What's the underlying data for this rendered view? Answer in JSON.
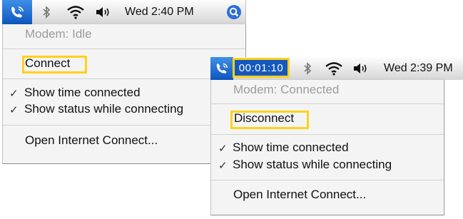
{
  "screen_before": {
    "menubar": {
      "clock": "Wed 2:40 PM"
    },
    "menu": {
      "status": "Modem: Idle",
      "action": "Connect",
      "option_time": "Show time connected",
      "option_status": "Show status while connecting",
      "open_app": "Open Internet Connect..."
    }
  },
  "screen_after": {
    "menubar": {
      "timer": "00:01:10",
      "clock": "Wed 2:39 PM"
    },
    "menu": {
      "status": "Modem: Connected",
      "action": "Disconnect",
      "option_time": "Show time connected",
      "option_status": "Show status while connecting",
      "open_app": "Open Internet Connect..."
    }
  },
  "check_glyph": "✓",
  "colors": {
    "accent_blue": "#1458bd",
    "callout_yellow": "#ffd21a"
  }
}
